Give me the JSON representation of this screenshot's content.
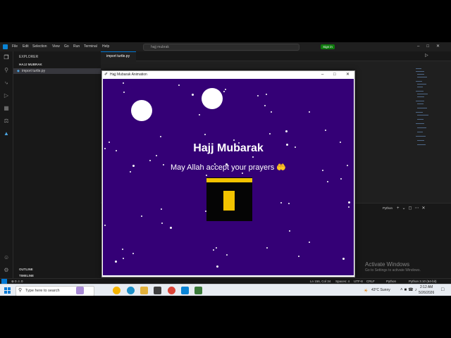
{
  "vscode": {
    "menu": [
      "File",
      "Edit",
      "Selection",
      "View",
      "Go",
      "Run",
      "Terminal",
      "Help"
    ],
    "search_text": "hajj mubrak",
    "signin_label": "Sign in",
    "explorer_title": "EXPLORER",
    "folder_name": "HAJJ MUBRAK",
    "file_name": "import turtle.py",
    "tab_label": "import turtle.py",
    "outline_label": "OUTLINE",
    "timeline_label": "TIMELINE",
    "panel_python_label": "Python",
    "status": {
      "problems": "⊗ 0 ⚠ 0",
      "position": "Ln 156, Col 34",
      "spaces": "Spaces: 4",
      "encoding": "UTF-8",
      "eol": "CRLF",
      "language": "Python",
      "interpreter": "Python 3.10 (64-bit)"
    },
    "activate_title": "Activate Windows",
    "activate_sub": "Go to Settings to activate Windows."
  },
  "turtle_window": {
    "title": "Hajj Mubarak Animation",
    "heading": "Hajj Mubarak",
    "subheading": "May Allah accept your prayers 🤲",
    "colors": {
      "background": "#340076",
      "moon": "#f2c300",
      "kaaba": "#050505",
      "gold": "#f2c300"
    }
  },
  "taskbar": {
    "search_placeholder": "Type here to search",
    "weather": "43°C  Sunny",
    "time": "2:12 AM",
    "date": "5/26/2026"
  }
}
